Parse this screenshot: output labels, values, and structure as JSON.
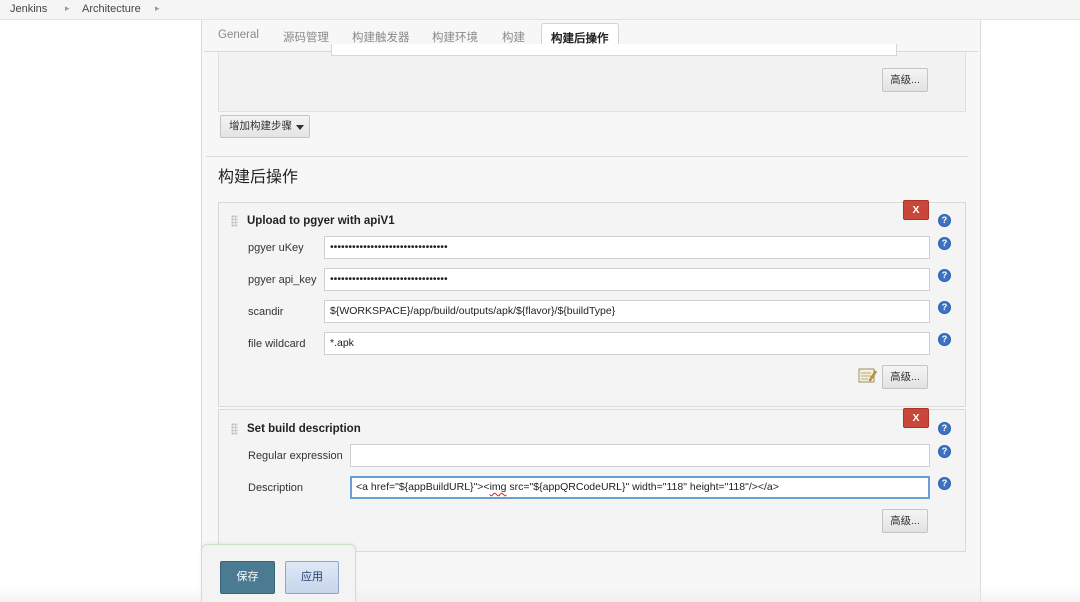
{
  "breadcrumb": {
    "items": [
      "Jenkins",
      "Architecture"
    ],
    "separator": "▸"
  },
  "tabs": [
    {
      "label": "General"
    },
    {
      "label": "源码管理"
    },
    {
      "label": "构建触发器"
    },
    {
      "label": "构建环境"
    },
    {
      "label": "构建"
    },
    {
      "label": "构建后操作",
      "active": true
    }
  ],
  "build": {
    "advanced_label": "高级...",
    "add_step_label": "增加构建步骤"
  },
  "post_build": {
    "section_title": "构建后操作",
    "pgyer": {
      "title": "Upload to pgyer with apiV1",
      "delete_label": "X",
      "ukey_label": "pgyer uKey",
      "ukey_value": "••••••••••••••••••••••••••••••••",
      "apikey_label": "pgyer api_key",
      "apikey_value": "••••••••••••••••••••••••••••••••",
      "scandir_label": "scandir",
      "scandir_value": "${WORKSPACE}/app/build/outputs/apk/${flavor}/${buildType}",
      "wildcard_label": "file wildcard",
      "wildcard_value": "*.apk",
      "advanced_label": "高级..."
    },
    "build_desc": {
      "title": "Set build description",
      "delete_label": "X",
      "regex_label": "Regular expression",
      "regex_value": "",
      "desc_label": "Description",
      "desc_prefix": "<a href=\"${appBuildURL}\"><",
      "desc_misspelled": "img",
      "desc_suffix": " src=\"${appQRCodeURL}\" width=\"118\" height=\"118\"/></a>",
      "advanced_label": "高级..."
    }
  },
  "actions": {
    "save_label": "保存",
    "apply_label": "应用"
  },
  "help_glyph": "?",
  "colors": {
    "save_button": "#4b7a93",
    "delete_button": "#c9473a",
    "help_icon": "#3c74c2",
    "focus_border": "#6b9fd4"
  }
}
